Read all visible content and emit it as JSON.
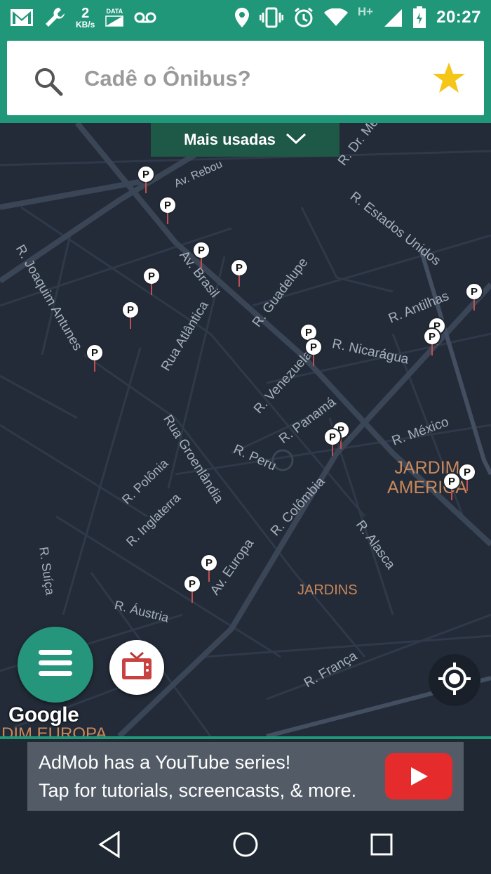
{
  "status_bar": {
    "net_speed_value": "2",
    "net_speed_unit": "KB/s",
    "data_label": "DATA",
    "network_type": "H+",
    "time": "20:27"
  },
  "search": {
    "placeholder": "Cadê o Ônibus?",
    "favorite_icon": "star-icon"
  },
  "map": {
    "dropdown_label": "Mais usadas",
    "streets": [
      "Av. Rebou",
      "R. Dr. Me",
      "R. Estados Unidos",
      "R. Joaquim Antunes",
      "Av. Brasil",
      "R. Guadelupe",
      "R. Antilhas",
      "Rua Atlântica",
      "R. Nicarágua",
      "R. Venezuela",
      "R. Panamá",
      "R. México",
      "Rua Groenlândia",
      "R. Peru",
      "R. Polônia",
      "R. Colômbia",
      "R. Inglaterra",
      "R. Alasca",
      "R. Suíça",
      "Av. Europa",
      "R. Áustria",
      "R. França"
    ],
    "districts": {
      "jardim_america": "JARDIM\nAMERICA",
      "jardins": "JARDINS",
      "cut_bottom": "DIM EUROPA"
    },
    "pin_label": "P",
    "attribution": "Google"
  },
  "ad": {
    "line1": "AdMob has a YouTube series!",
    "line2": "Tap for tutorials, screencasts, & more."
  },
  "colors": {
    "primary": "#21977a",
    "map_bg": "#232b38",
    "star": "#f5c518",
    "district": "#c9885a"
  }
}
